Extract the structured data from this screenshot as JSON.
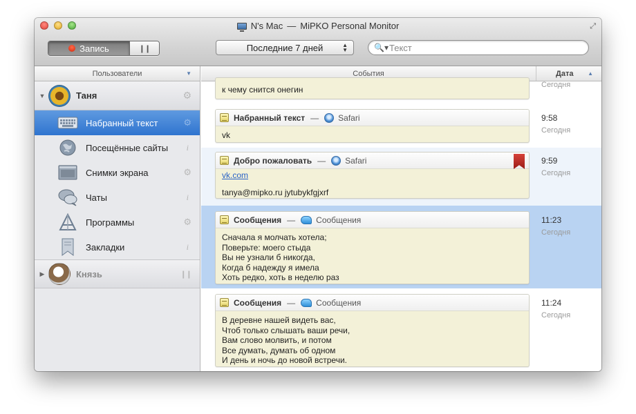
{
  "window": {
    "title_device": "N's Mac",
    "title_separator": "—",
    "title_app": "MiPKO Personal Monitor"
  },
  "toolbar": {
    "record_label": "Запись",
    "pause_label": "❙❙",
    "period_value": "Последние 7 дней",
    "search_placeholder": "Текст"
  },
  "sidebar": {
    "header": "Пользователи",
    "users": [
      {
        "name": "Таня",
        "expanded": true
      },
      {
        "name": "Князь",
        "expanded": false
      }
    ],
    "items": [
      {
        "label": "Набранный текст",
        "icon": "keyboard-icon",
        "selected": true
      },
      {
        "label": "Посещённые сайты",
        "icon": "globe-icon"
      },
      {
        "label": "Снимки экрана",
        "icon": "screen-icon"
      },
      {
        "label": "Чаты",
        "icon": "chat-icon"
      },
      {
        "label": "Программы",
        "icon": "apps-icon"
      },
      {
        "label": "Закладки",
        "icon": "bookmark-icon"
      }
    ]
  },
  "list": {
    "header_events": "События",
    "header_date": "Дата",
    "partial": {
      "text": "к чему снится онегин",
      "day": "Сегодня"
    },
    "events": [
      {
        "type": "Набранный текст",
        "app": "Safari",
        "app_icon": "safari-icon",
        "time": "9:58",
        "day": "Сегодня",
        "lines": [
          "vk"
        ]
      },
      {
        "type": "Добро пожаловать",
        "app": "Safari",
        "app_icon": "safari-icon",
        "time": "9:59",
        "day": "Сегодня",
        "link": "vk.com",
        "lines": [
          "tanya@mipko.ru jytubykfgjxrf"
        ]
      },
      {
        "type": "Сообщения",
        "app": "Сообщения",
        "app_icon": "messages-icon",
        "time": "11:23",
        "day": "Сегодня",
        "lines": [
          "Сначала я молчать хотела;",
          "Поверьте: моего стыда",
          "Вы не узнали б никогда,",
          "Когда б надежду я имела",
          "Хоть редко, хоть в неделю раз"
        ]
      },
      {
        "type": "Сообщения",
        "app": "Сообщения",
        "app_icon": "messages-icon",
        "time": "11:24",
        "day": "Сегодня",
        "lines": [
          "В деревне нашей видеть вас,",
          "Чтоб только слышать ваши речи,",
          "Вам слово молвить, и потом",
          "Все думать, думать об одном",
          "И день и ночь до новой встречи."
        ]
      }
    ]
  }
}
